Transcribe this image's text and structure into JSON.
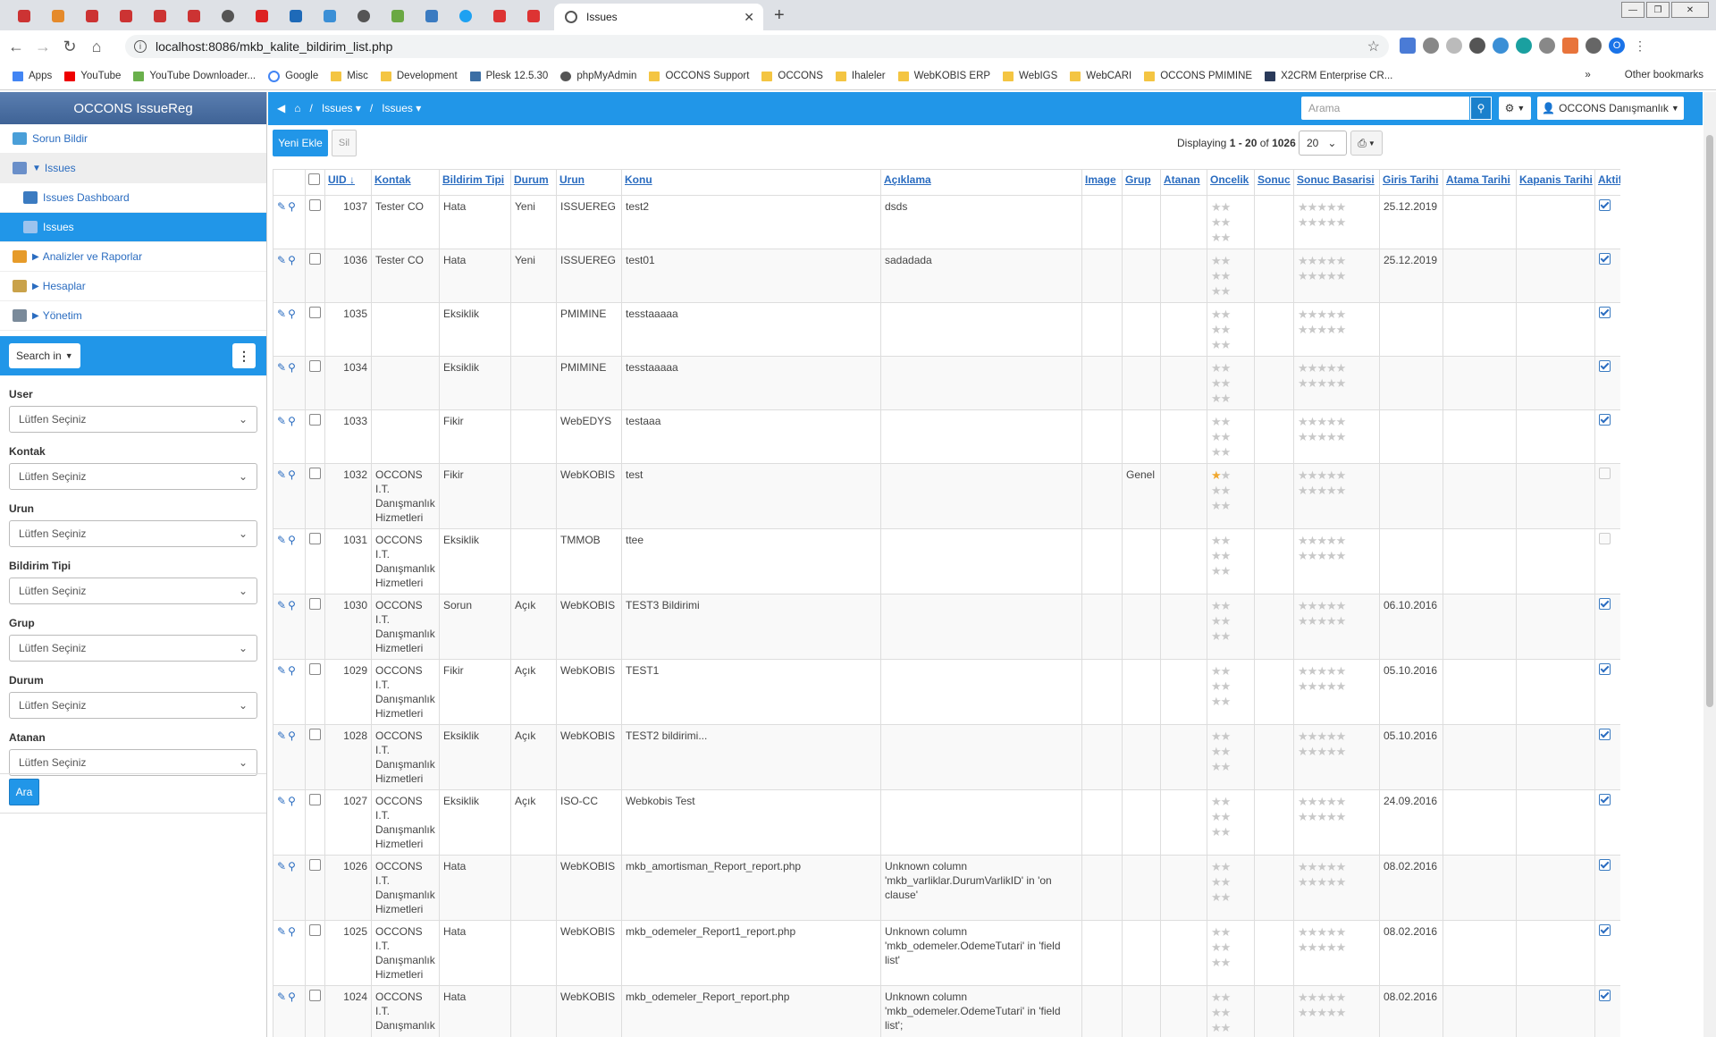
{
  "browser": {
    "tab_title": "Issues",
    "url": "localhost:8086/mkb_kalite_bildirim_list.php",
    "bookmarks": [
      "Apps",
      "YouTube",
      "YouTube Downloader...",
      "Google",
      "Misc",
      "Development",
      "Plesk 12.5.30",
      "phpMyAdmin",
      "OCCONS Support",
      "OCCONS",
      "Ihaleler",
      "WebKOBIS ERP",
      "WebIGS",
      "WebCARI",
      "OCCONS PMIMINE",
      "X2CRM Enterprise CR..."
    ],
    "other_bookmarks": "Other bookmarks",
    "avatar_letter": "O"
  },
  "sidebar": {
    "brand": "OCCONS IssueReg",
    "items": [
      {
        "label": "Sorun Bildir"
      },
      {
        "label": "Issues"
      },
      {
        "label": "Issues Dashboard"
      },
      {
        "label": "Issues"
      },
      {
        "label": "Analizler ve Raporlar"
      },
      {
        "label": "Hesaplar"
      },
      {
        "label": "Yönetim"
      }
    ],
    "search_in": "Search in",
    "filters": [
      {
        "label": "User",
        "value": "Lütfen Seçiniz"
      },
      {
        "label": "Kontak",
        "value": "Lütfen Seçiniz"
      },
      {
        "label": "Urun",
        "value": "Lütfen Seçiniz"
      },
      {
        "label": "Bildirim Tipi",
        "value": "Lütfen Seçiniz"
      },
      {
        "label": "Grup",
        "value": "Lütfen Seçiniz"
      },
      {
        "label": "Durum",
        "value": "Lütfen Seçiniz"
      },
      {
        "label": "Atanan",
        "value": "Lütfen Seçiniz"
      }
    ],
    "search_button": "Ara"
  },
  "topbar": {
    "crumb1": "Issues",
    "crumb2": "Issues",
    "search_placeholder": "Arama",
    "user": "OCCONS Danışmanlık"
  },
  "toolbar": {
    "new_label": "Yeni Ekle",
    "delete_label": "Sil",
    "displaying_prefix": "Displaying ",
    "range": "1 - 20",
    "of": " of ",
    "total": "1026",
    "page_size": "20"
  },
  "columns": [
    "UID",
    "Kontak",
    "Bildirim Tipi",
    "Durum",
    "Urun",
    "Konu",
    "Açıklama",
    "Image",
    "Grup",
    "Atanan",
    "Oncelik",
    "Sonuc",
    "Sonuc Basarisi",
    "Giris Tarihi",
    "Atama Tarihi",
    "Kapanis Tarihi",
    "Aktif"
  ],
  "rows": [
    {
      "uid": "1037",
      "kontak": "Tester CO",
      "tip": "Hata",
      "durum": "Yeni",
      "urun": "ISSUEREG",
      "konu": "test2",
      "aciklama": "dsds",
      "grup": "",
      "oncelik": 0,
      "giris": "25.12.2019",
      "aktif": true
    },
    {
      "uid": "1036",
      "kontak": "Tester CO",
      "tip": "Hata",
      "durum": "Yeni",
      "urun": "ISSUEREG",
      "konu": "test01",
      "aciklama": "sadadada",
      "grup": "",
      "oncelik": 0,
      "giris": "25.12.2019",
      "aktif": true
    },
    {
      "uid": "1035",
      "kontak": "",
      "tip": "Eksiklik",
      "durum": "",
      "urun": "PMIMINE",
      "konu": "tesstaaaaa",
      "aciklama": "",
      "grup": "",
      "oncelik": 0,
      "giris": "",
      "aktif": true
    },
    {
      "uid": "1034",
      "kontak": "",
      "tip": "Eksiklik",
      "durum": "",
      "urun": "PMIMINE",
      "konu": "tesstaaaaa",
      "aciklama": "",
      "grup": "",
      "oncelik": 0,
      "giris": "",
      "aktif": true
    },
    {
      "uid": "1033",
      "kontak": "",
      "tip": "Fikir",
      "durum": "",
      "urun": "WebEDYS",
      "konu": "testaaa",
      "aciklama": "",
      "grup": "",
      "oncelik": 0,
      "giris": "",
      "aktif": true
    },
    {
      "uid": "1032",
      "kontak": "OCCONS I.T. Danışmanlık Hizmetleri",
      "tip": "Fikir",
      "durum": "",
      "urun": "WebKOBIS",
      "konu": "test",
      "aciklama": "",
      "grup": "Genel",
      "oncelik": 1,
      "giris": "",
      "aktif": false
    },
    {
      "uid": "1031",
      "kontak": "OCCONS I.T. Danışmanlık Hizmetleri",
      "tip": "Eksiklik",
      "durum": "",
      "urun": "TMMOB",
      "konu": "ttee",
      "aciklama": "",
      "grup": "",
      "oncelik": 0,
      "giris": "",
      "aktif": false
    },
    {
      "uid": "1030",
      "kontak": "OCCONS I.T. Danışmanlık Hizmetleri",
      "tip": "Sorun",
      "durum": "Açık",
      "urun": "WebKOBIS",
      "konu": "TEST3 Bildirimi",
      "aciklama": "",
      "grup": "",
      "oncelik": 0,
      "giris": "06.10.2016",
      "aktif": true
    },
    {
      "uid": "1029",
      "kontak": "OCCONS I.T. Danışmanlık Hizmetleri",
      "tip": "Fikir",
      "durum": "Açık",
      "urun": "WebKOBIS",
      "konu": "TEST1",
      "aciklama": "",
      "grup": "",
      "oncelik": 0,
      "giris": "05.10.2016",
      "aktif": true
    },
    {
      "uid": "1028",
      "kontak": "OCCONS I.T. Danışmanlık Hizmetleri",
      "tip": "Eksiklik",
      "durum": "Açık",
      "urun": "WebKOBIS",
      "konu": "TEST2 bildirimi...",
      "aciklama": "",
      "grup": "",
      "oncelik": 0,
      "giris": "05.10.2016",
      "aktif": true
    },
    {
      "uid": "1027",
      "kontak": "OCCONS I.T. Danışmanlık Hizmetleri",
      "tip": "Eksiklik",
      "durum": "Açık",
      "urun": "ISO-CC",
      "konu": "Webkobis Test",
      "aciklama": "",
      "grup": "",
      "oncelik": 0,
      "giris": "24.09.2016",
      "aktif": true
    },
    {
      "uid": "1026",
      "kontak": "OCCONS I.T. Danışmanlık Hizmetleri",
      "tip": "Hata",
      "durum": "",
      "urun": "WebKOBIS",
      "konu": "mkb_amortisman_Report_report.php",
      "aciklama": "Unknown column 'mkb_varliklar.DurumVarlikID' in 'on clause'",
      "grup": "",
      "oncelik": 0,
      "giris": "08.02.2016",
      "aktif": true
    },
    {
      "uid": "1025",
      "kontak": "OCCONS I.T. Danışmanlık Hizmetleri",
      "tip": "Hata",
      "durum": "",
      "urun": "WebKOBIS",
      "konu": "mkb_odemeler_Report1_report.php",
      "aciklama": "Unknown column 'mkb_odemeler.OdemeTutari' in 'field list'",
      "grup": "",
      "oncelik": 0,
      "giris": "08.02.2016",
      "aktif": true
    },
    {
      "uid": "1024",
      "kontak": "OCCONS I.T. Danışmanlık",
      "tip": "Hata",
      "durum": "",
      "urun": "WebKOBIS",
      "konu": "mkb_odemeler_Report_report.php",
      "aciklama": "Unknown column 'mkb_odemeler.OdemeTutari' in 'field list';",
      "grup": "",
      "oncelik": 0,
      "giris": "08.02.2016",
      "aktif": true
    }
  ]
}
